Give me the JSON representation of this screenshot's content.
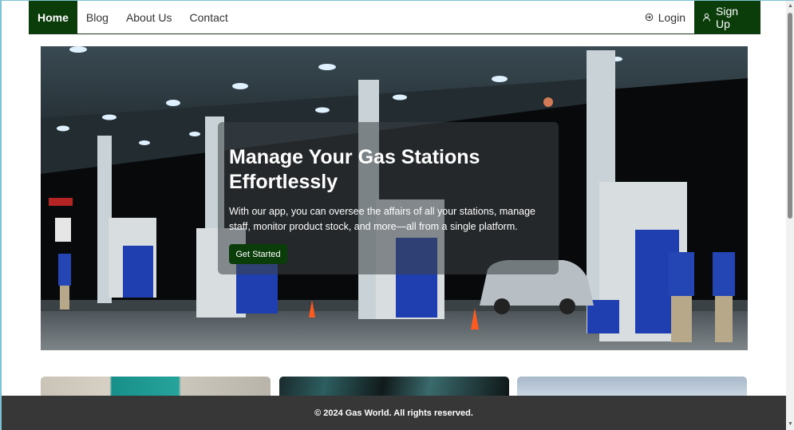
{
  "nav": {
    "links": [
      {
        "label": "Home",
        "active": true
      },
      {
        "label": "Blog",
        "active": false
      },
      {
        "label": "About Us",
        "active": false
      },
      {
        "label": "Contact",
        "active": false
      }
    ],
    "login_label": "Login",
    "signup_label": "Sign Up",
    "login_icon": "login-arrow-icon",
    "signup_icon": "user-icon"
  },
  "hero": {
    "title": "Manage Your Gas Stations Effortlessly",
    "text": "With our app, you can oversee the affairs of all your stations, manage staff, monitor product stock, and more—all from a single platform.",
    "cta_label": "Get Started"
  },
  "footer": {
    "text": "© 2024 Gas World. All rights reserved."
  },
  "colors": {
    "brand": "#0a3d0a",
    "footer_bg": "#373737",
    "hero_overlay": "rgba(60,65,70,0.55)"
  }
}
